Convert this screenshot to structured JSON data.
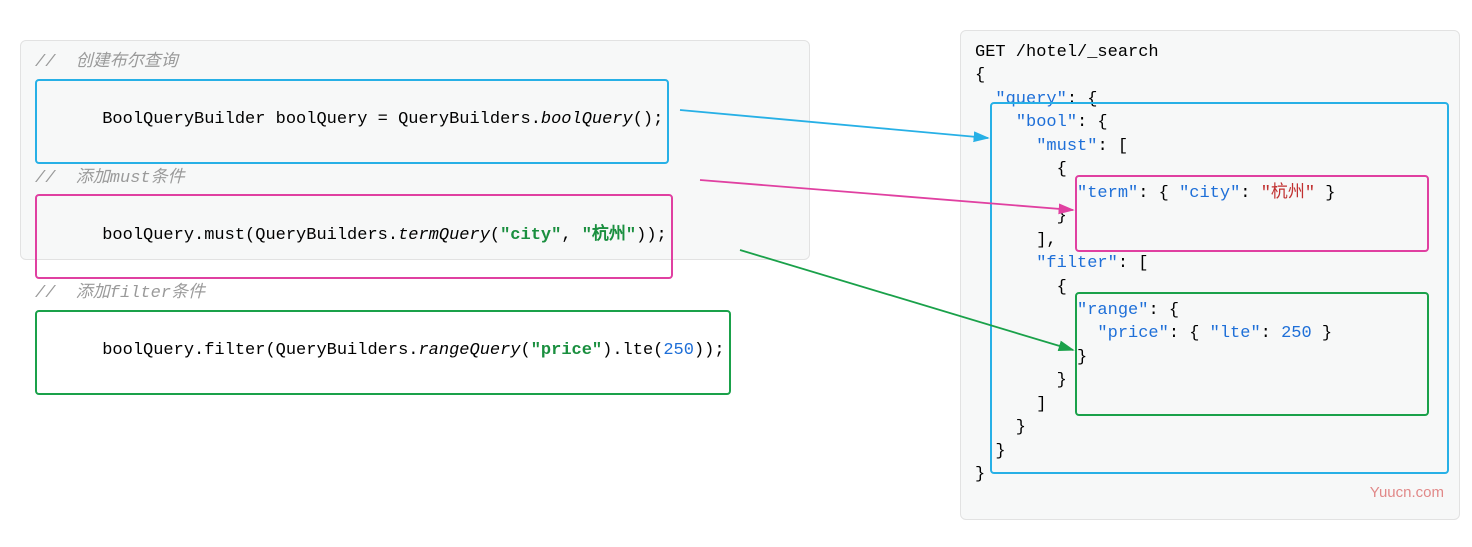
{
  "left": {
    "comment1": "//  创建布尔查询",
    "line1_a": "BoolQueryBuilder boolQuery = QueryBuilders.",
    "line1_b": "boolQuery",
    "line1_c": "();",
    "comment2": "//  添加must条件",
    "line2_a": "boolQuery.must(QueryBuilders.",
    "line2_b": "termQuery",
    "line2_c": "(",
    "line2_d": "\"city\"",
    "line2_e": ", ",
    "line2_f": "\"杭州\"",
    "line2_g": "));",
    "comment3": "//  添加filter条件",
    "line3_a": "boolQuery.filter(QueryBuilders.",
    "line3_b": "rangeQuery",
    "line3_c": "(",
    "line3_d": "\"price\"",
    "line3_e": ").lte(",
    "line3_f": "250",
    "line3_g": "));"
  },
  "right": {
    "l1": "GET /hotel/_search",
    "l2": "{",
    "l3a": "  ",
    "l3b": "\"query\"",
    "l3c": ": {",
    "l4a": "    ",
    "l4b": "\"bool\"",
    "l4c": ": {",
    "l5a": "      ",
    "l5b": "\"must\"",
    "l5c": ": [",
    "l6": "        {",
    "l7a": "          ",
    "l7b": "\"term\"",
    "l7c": ": { ",
    "l7d": "\"city\"",
    "l7e": ": ",
    "l7f": "\"杭州\"",
    "l7g": " }",
    "l8": "        }",
    "l9": "      ],",
    "l10a": "      ",
    "l10b": "\"filter\"",
    "l10c": ": [",
    "l11": "        {",
    "l12a": "          ",
    "l12b": "\"range\"",
    "l12c": ": {",
    "l13a": "            ",
    "l13b": "\"price\"",
    "l13c": ": { ",
    "l13d": "\"lte\"",
    "l13e": ": ",
    "l13f": "250",
    "l13g": " }",
    "l14": "          }",
    "l15": "        }",
    "l16": "      ]",
    "l17": "    }",
    "l18": "  }",
    "l19": "}"
  },
  "watermark": "Yuucn.com"
}
